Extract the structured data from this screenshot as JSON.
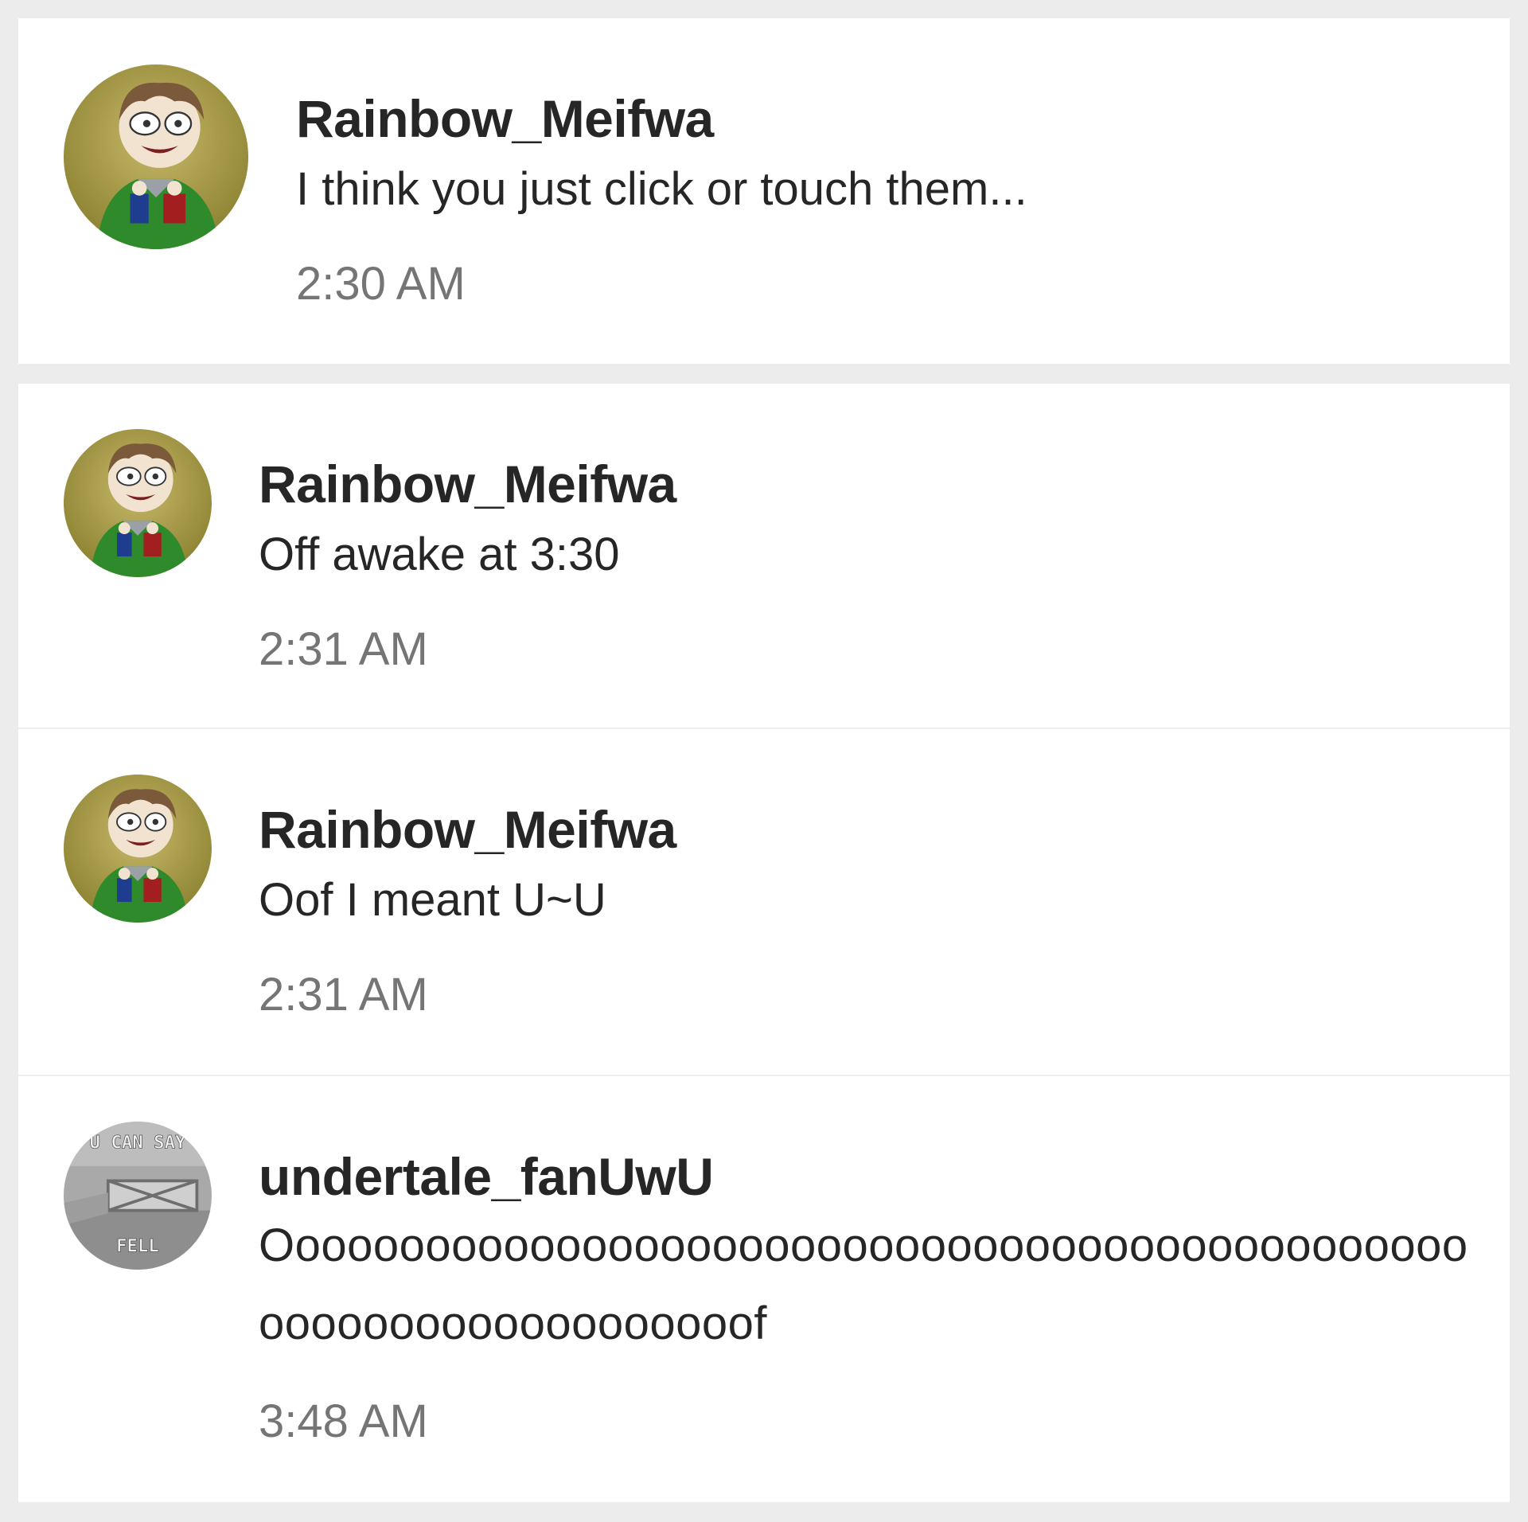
{
  "messages": [
    {
      "username": "Rainbow_Meifwa",
      "text": "I think you just click or touch them...",
      "time": "2:30 AM",
      "avatar": "cartoon-character-avatar"
    },
    {
      "username": "Rainbow_Meifwa",
      "text": "Off awake at 3:30",
      "time": "2:31 AM",
      "avatar": "cartoon-character-avatar"
    },
    {
      "username": "Rainbow_Meifwa",
      "text": "Oof I meant U~U",
      "time": "2:31 AM",
      "avatar": "cartoon-character-avatar"
    },
    {
      "username": "undertale_fanUwU",
      "text": "Ooooooooooooooooooooooooooooooooooooooooooooooooooooooooooooooooof",
      "time": "3:48 AM",
      "avatar": "grayscale-meme-avatar",
      "avatar_text_top": "U CAN SAY",
      "avatar_text_bottom": "FELL"
    }
  ],
  "colors": {
    "background": "#ececec",
    "card": "#ffffff",
    "username": "#262626",
    "message_text": "#262626",
    "timestamp": "#757575",
    "divider": "#eeeeee"
  }
}
